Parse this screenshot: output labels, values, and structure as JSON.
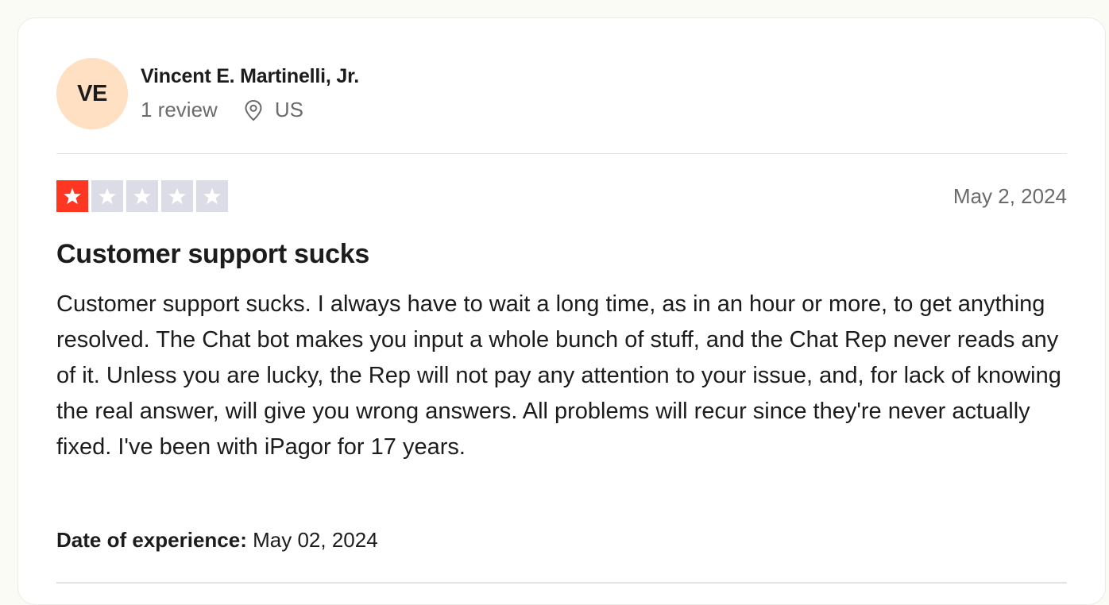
{
  "reviewer": {
    "initials": "VE",
    "avatar_color": "#ffe0c2",
    "name": "Vincent E. Martinelli, Jr.",
    "review_count": "1 review",
    "location_icon": "location-pin-icon",
    "country": "US"
  },
  "review": {
    "rating": 1,
    "rating_max": 5,
    "star_filled_color": "#ff3722",
    "star_empty_color": "#dcdce6",
    "date": "May 2, 2024",
    "title": "Customer support sucks",
    "body": "Customer support sucks. I always have to wait a long time, as in an hour or more, to get anything resolved. The Chat bot makes you input a whole bunch of stuff, and the Chat Rep never reads any of it. Unless you are lucky, the Rep will not pay any attention to your issue, and, for lack of knowing the real answer, will give you wrong answers. All problems will recur since they're never actually fixed. I've been with iPagor for 17 years.",
    "experience_label": "Date of experience:",
    "experience_date": "May 02, 2024"
  }
}
